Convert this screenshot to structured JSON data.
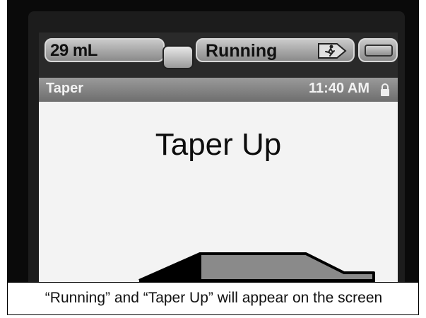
{
  "status_bar": {
    "volume": "29 mL",
    "status": "Running",
    "icons": [
      "syringe-icon",
      "running-person-icon",
      "battery-icon"
    ]
  },
  "title_bar": {
    "mode": "Taper",
    "time": "11:40 AM",
    "icons": [
      "lock-icon"
    ]
  },
  "main": {
    "title": "Taper Up"
  },
  "caption": {
    "text": "“Running” and “Taper Up” will appear on the screen"
  },
  "colors": {
    "graph_fill": "#8a8a8a",
    "graph_outline": "#000000"
  }
}
